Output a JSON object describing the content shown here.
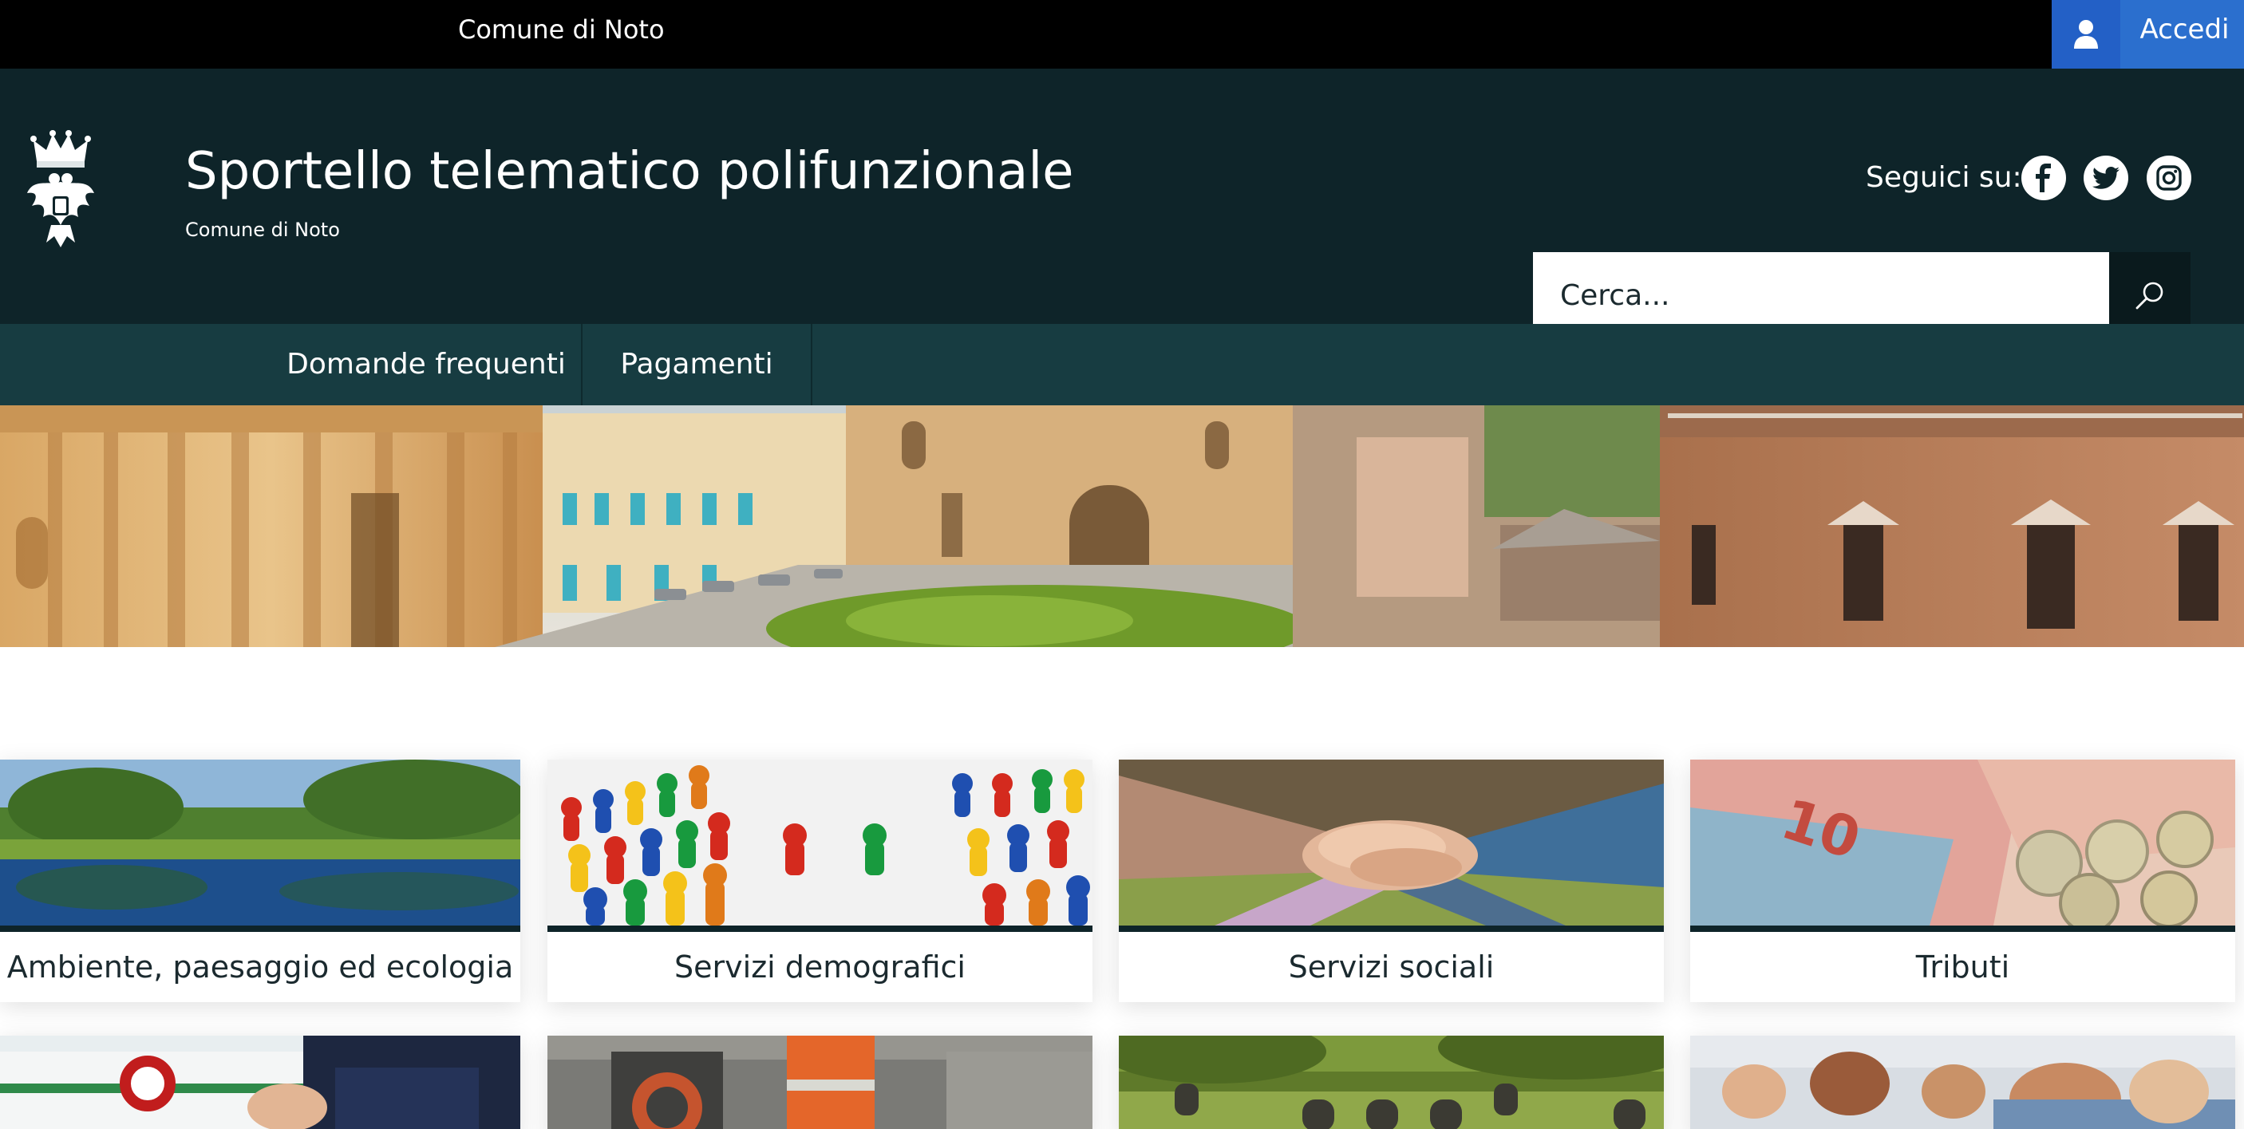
{
  "topbar": {
    "entity_name": "Comune di Noto",
    "login_label": "Accedi"
  },
  "header": {
    "title": "Sportello telematico polifunzionale",
    "subtitle": "Comune di Noto",
    "follow_label": "Seguici su:",
    "social": [
      "facebook-icon",
      "twitter-icon",
      "instagram-icon"
    ],
    "search": {
      "placeholder": "Cerca..."
    }
  },
  "nav": {
    "items": [
      {
        "label": "Domande frequenti"
      },
      {
        "label": "Pagamenti"
      }
    ]
  },
  "categories": [
    {
      "label": "Ambiente, paesaggio ed ecologia"
    },
    {
      "label": "Servizi demografici"
    },
    {
      "label": "Servizi sociali"
    },
    {
      "label": "Tributi"
    }
  ],
  "colors": {
    "topbar": "#000000",
    "header": "#0e2429",
    "nav": "#173c41",
    "login": "#2b6fce",
    "search_button": "#0a1a1d"
  }
}
